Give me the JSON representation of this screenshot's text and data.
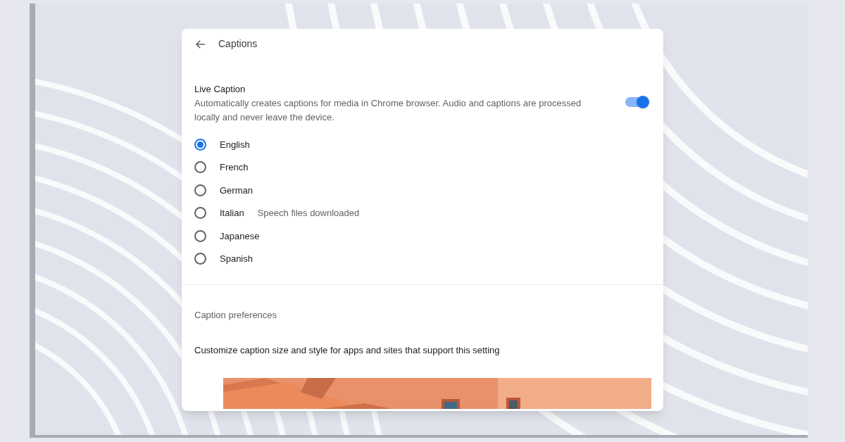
{
  "page": {
    "title": "Captions"
  },
  "live_caption": {
    "label": "Live Caption",
    "description": "Automatically creates captions for media in Chrome browser. Audio and captions are processed locally and never leave the device.",
    "on": true
  },
  "languages": [
    {
      "label": "English",
      "selected": true
    },
    {
      "label": "French",
      "selected": false
    },
    {
      "label": "German",
      "selected": false
    },
    {
      "label": "Italian",
      "selected": false,
      "status": "Speech files downloaded"
    },
    {
      "label": "Japanese",
      "selected": false
    },
    {
      "label": "Spanish",
      "selected": false
    }
  ],
  "caption_preferences": {
    "heading": "Caption preferences",
    "description": "Customize caption size and style for apps and sites that support this setting"
  }
}
